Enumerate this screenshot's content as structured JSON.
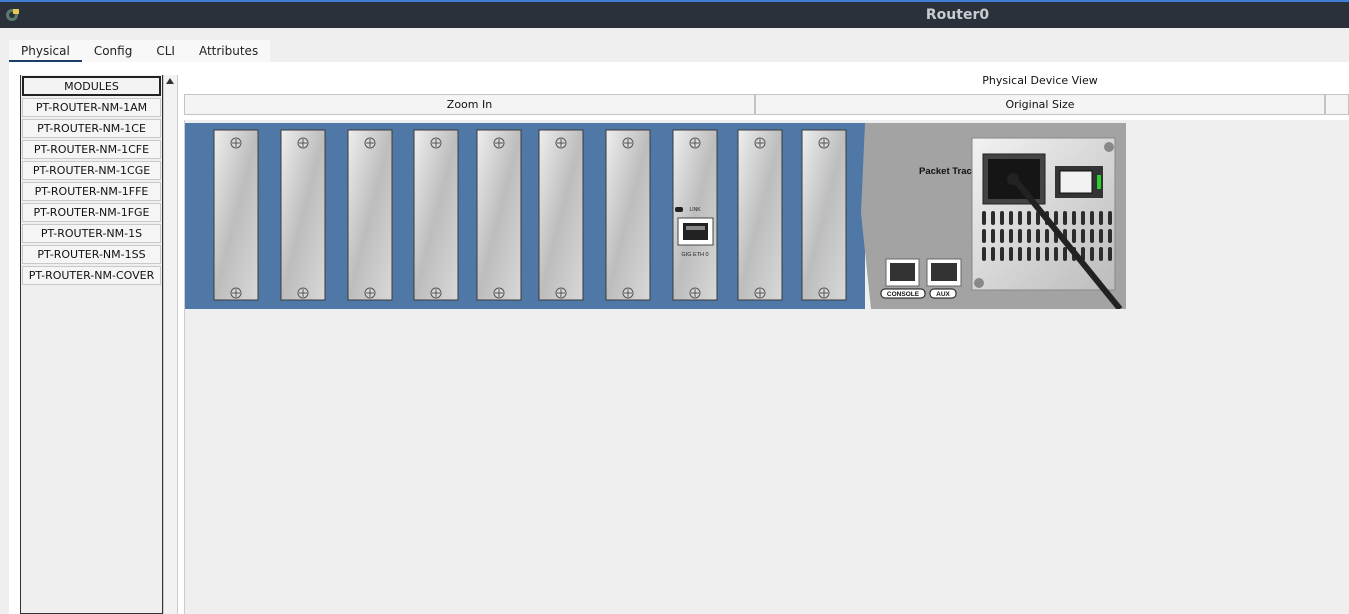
{
  "window": {
    "title": "Router0",
    "app_icon": "packet-tracer-icon"
  },
  "tabs": [
    "Physical",
    "Config",
    "CLI",
    "Attributes"
  ],
  "active_tab": "Physical",
  "modules": {
    "header": "MODULES",
    "items": [
      "PT-ROUTER-NM-1AM",
      "PT-ROUTER-NM-1CE",
      "PT-ROUTER-NM-1CFE",
      "PT-ROUTER-NM-1CGE",
      "PT-ROUTER-NM-1FFE",
      "PT-ROUTER-NM-1FGE",
      "PT-ROUTER-NM-1S",
      "PT-ROUTER-NM-1SS",
      "PT-ROUTER-NM-COVER"
    ]
  },
  "view": {
    "label": "Physical Device View",
    "zoom_in": "Zoom In",
    "original_size": "Original Size"
  },
  "device": {
    "brand_label": "Packet Tracer Router",
    "slot_count": 10,
    "filled_slot_port_label": "GIG ETH 0",
    "link_label": "LINK",
    "console_label": "CONSOLE",
    "aux_label": "AUX",
    "colors": {
      "chassis": "#4f78a6",
      "panel": "#a3a3a3",
      "power_led": "#2bd12b"
    }
  }
}
